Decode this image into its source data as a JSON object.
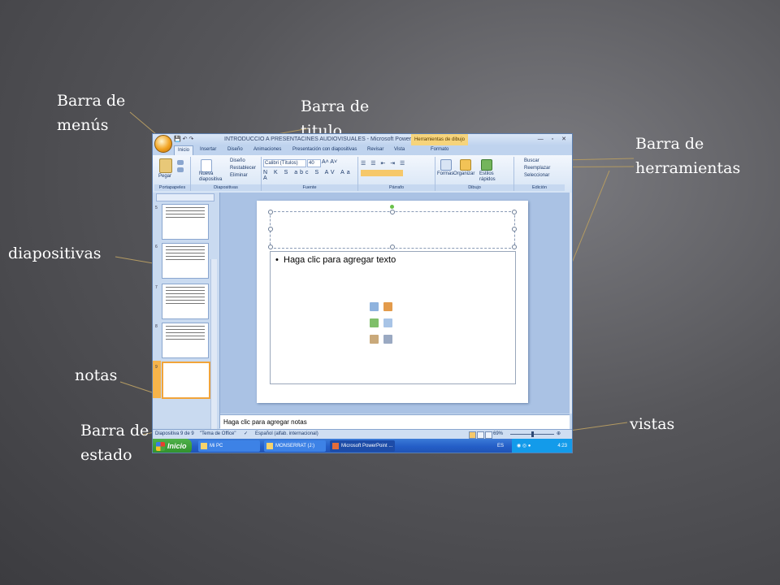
{
  "callouts": {
    "barra_menus": "Barra de\nmenús",
    "barra_titulo": "Barra de\ntitulo",
    "barra_herramientas": "Barra de\nherramientas",
    "diapositivas": "diapositivas",
    "notas": "notas",
    "barra_estado": "Barra de\nestado",
    "vistas": "vistas"
  },
  "window": {
    "title": "INTRODUCCIO A PRESENTACINES AUDIOVISUALES - Microsoft PowerPoint",
    "contextual_tab": "Herramientas de dibujo",
    "controls": "— ▫ ✕"
  },
  "tabs": [
    "Inicio",
    "Insertar",
    "Diseño",
    "Animaciones",
    "Presentación con diapositivas",
    "Revisar",
    "Vista",
    "Formato"
  ],
  "ribbon": {
    "groups": [
      "Portapapeles",
      "Diapositivas",
      "Fuente",
      "Párrafo",
      "Dibujo",
      "Edición"
    ],
    "paste": "Pegar",
    "new_slide": "Nueva diapositiva",
    "layout": "Diseño",
    "reset": "Restablecer",
    "delete": "Eliminar",
    "font_name": "Calibri (Títulos)",
    "font_size": "40",
    "shapes": "Formas",
    "arrange": "Organizar",
    "quick_styles": "Estilos rápidos",
    "find": "Buscar",
    "replace": "Reemplazar",
    "select": "Seleccionar"
  },
  "thumbnails": [
    "5",
    "6",
    "7",
    "8",
    "9"
  ],
  "slide": {
    "body_placeholder": "Haga clic para agregar texto"
  },
  "notes": {
    "placeholder": "Haga clic para agregar notas"
  },
  "status": {
    "slide_count": "Diapositiva 9 de 9",
    "theme": "\"Tema de Office\"",
    "language": "Español (alfab. internacional)",
    "zoom": "69%"
  },
  "taskbar": {
    "start": "Inicio",
    "tasks": [
      "Mi PC",
      "MONSERRAT (J:)",
      "Microsoft PowerPoint ..."
    ],
    "lang": "ES",
    "clock": "4:23"
  }
}
